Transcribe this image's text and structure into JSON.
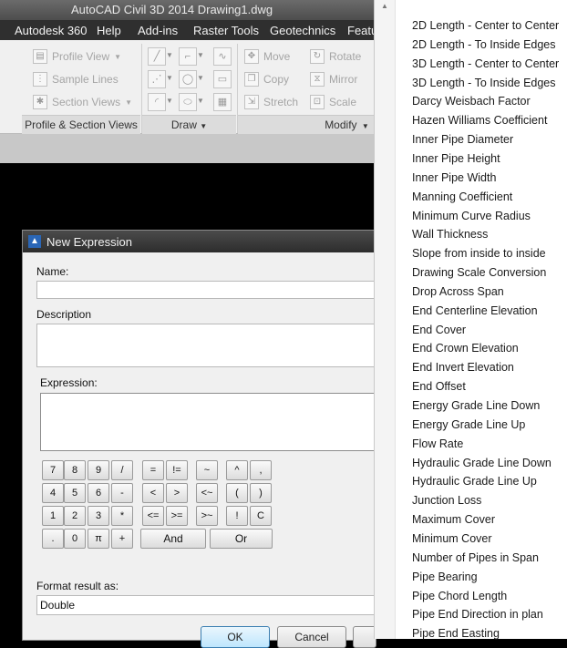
{
  "app": {
    "title": "AutoCAD Civil 3D 2014    Drawing1.dwg"
  },
  "menu": [
    "Autodesk 360",
    "Help",
    "Add-ins",
    "Raster Tools",
    "Geotechnics",
    "Featu"
  ],
  "ribbon": {
    "profile_view": "Profile View",
    "sample_lines": "Sample Lines",
    "section_views": "Section Views",
    "panel_profile": "Profile & Section Views",
    "panel_draw": "Draw",
    "panel_modify": "Modify",
    "move": "Move",
    "copy": "Copy",
    "stretch": "Stretch",
    "rotate": "Rotate",
    "mirror": "Mirror",
    "scale": "Scale"
  },
  "dialog": {
    "title": "New Expression",
    "name_label": "Name:",
    "name_value": "",
    "description_label": "Description",
    "description_value": "",
    "expression_label": "Expression:",
    "expression_value": "",
    "keys": [
      "7",
      "8",
      "9",
      "/",
      "=",
      "!=",
      "~",
      "^",
      ",",
      "4",
      "5",
      "6",
      "-",
      "<",
      ">",
      "<~",
      "(",
      ")",
      "1",
      "2",
      "3",
      "*",
      "<=",
      ">=",
      ">~",
      "!",
      "C",
      ".",
      "0",
      "π",
      "+"
    ],
    "and_label": "And",
    "or_label": "Or",
    "format_label": "Format result as:",
    "format_value": "Double",
    "ok_label": "OK",
    "cancel_label": "Cancel"
  },
  "properties": [
    "2D Length - Center to Center",
    "2D Length - To Inside Edges",
    "3D Length - Center to Center",
    "3D Length - To Inside Edges",
    "Darcy Weisbach Factor",
    "Hazen Williams Coefficient",
    "Inner Pipe Diameter",
    "Inner Pipe Height",
    "Inner Pipe Width",
    "Manning Coefficient",
    "Minimum Curve Radius",
    "Wall Thickness",
    "Slope from inside to inside",
    "Drawing Scale Conversion",
    "Drop Across Span",
    "End Centerline Elevation",
    "End Cover",
    "End Crown Elevation",
    "End Invert Elevation",
    "End Offset",
    "Energy Grade Line Down",
    "Energy Grade Line Up",
    "Flow Rate",
    "Hydraulic Grade Line Down",
    "Hydraulic Grade Line Up",
    "Junction Loss",
    "Maximum Cover",
    "Minimum Cover",
    "Number of Pipes in Span",
    "Pipe Bearing",
    "Pipe Chord Length",
    "Pipe End Direction in plan",
    "Pipe End Easting"
  ]
}
